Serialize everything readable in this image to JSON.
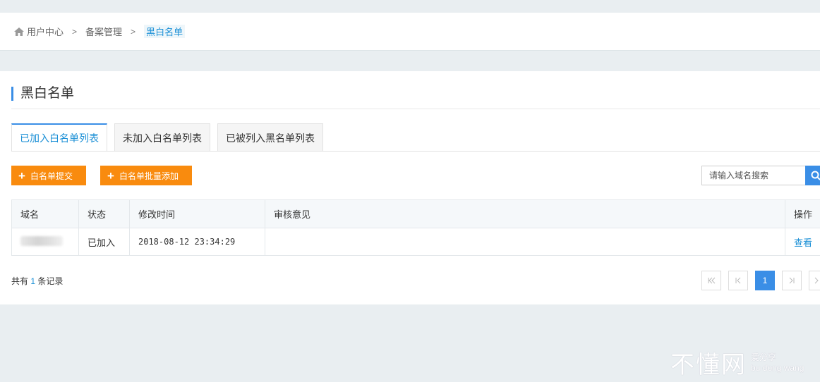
{
  "breadcrumb": {
    "home": "用户中心",
    "section": "备案管理",
    "current": "黑白名单",
    "separator": ">"
  },
  "page": {
    "title": "黑白名单"
  },
  "tabs": [
    {
      "label": "已加入白名单列表",
      "active": true
    },
    {
      "label": "未加入白名单列表",
      "active": false
    },
    {
      "label": "已被列入黑名单列表",
      "active": false
    }
  ],
  "actions": {
    "submit_label": "白名单提交",
    "batch_add_label": "白名单批量添加"
  },
  "search": {
    "placeholder": "请输入域名搜索",
    "icon": "search-icon"
  },
  "table": {
    "headers": [
      "域名",
      "状态",
      "修改时间",
      "审核意见",
      "操作"
    ],
    "rows": [
      {
        "domain": "",
        "status": "已加入",
        "modified": "2018-08-12 23:34:29",
        "opinion": "",
        "action": "查看"
      }
    ]
  },
  "footer": {
    "total_prefix": "共有",
    "total_count": "1",
    "total_suffix": "条记录"
  },
  "pagination": {
    "current_page": "1"
  },
  "watermark": {
    "main": "不懂网",
    "sub1": "爱分享",
    "sub2": "bu dong wang"
  },
  "colors": {
    "accent": "#3a8ee6",
    "orange": "#f98b0e",
    "link": "#1a8fd6"
  }
}
